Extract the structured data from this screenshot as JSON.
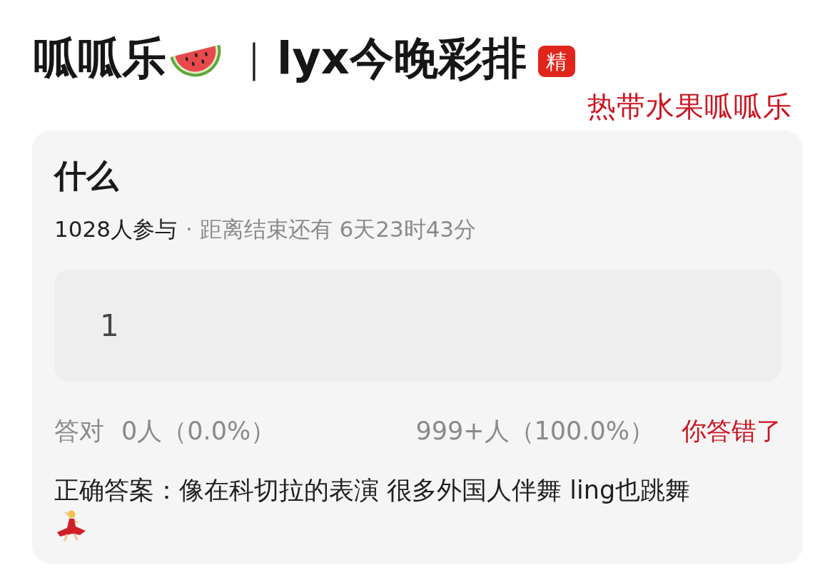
{
  "header": {
    "title": "呱呱乐",
    "separator": "｜",
    "subtitle": "lyx今晚彩排",
    "badge": "精"
  },
  "annotation": "热带水果呱呱乐",
  "quiz": {
    "question": "什么",
    "participants": "1028人参与",
    "countdown": "· 距离结束还有 6天23时43分",
    "answer": "1",
    "correct_stats": {
      "label": "答对",
      "value": "0人（0.0%）"
    },
    "wrong_stats": "999+人（100.0%）",
    "result": "你答错了",
    "correct_answer": "正确答案：像在科切拉的表演 很多外国人伴舞 ling也跳舞"
  }
}
